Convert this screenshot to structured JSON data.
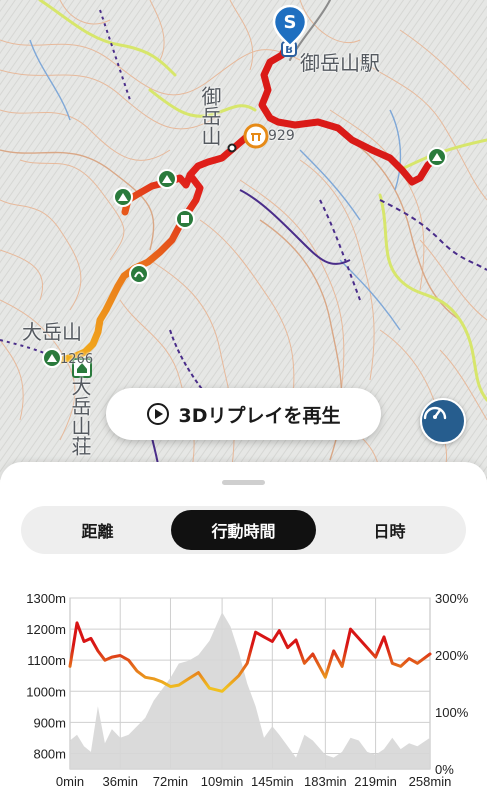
{
  "map": {
    "station_label": "御岳山駅",
    "mountain_label": "御岳山",
    "peak_label": "大岳山",
    "hut_label": "大岳山荘",
    "elev_label_1": "929",
    "elev_label_2": "1266",
    "start_marker": "S",
    "goal_marker": "G"
  },
  "replay_button": {
    "label": "3Dリプレイを再生"
  },
  "tabs": [
    {
      "label": "距離",
      "active": false
    },
    {
      "label": "行動時間",
      "active": true
    },
    {
      "label": "日時",
      "active": false
    }
  ],
  "chart_data": {
    "type": "line",
    "x": [
      0,
      5,
      10,
      15,
      20,
      25,
      30,
      36,
      42,
      48,
      54,
      60,
      66,
      72,
      78,
      85,
      92,
      100,
      109,
      115,
      121,
      127,
      133,
      139,
      145,
      150,
      156,
      162,
      168,
      174,
      183,
      189,
      195,
      201,
      207,
      213,
      219,
      225,
      231,
      237,
      243,
      249,
      258
    ],
    "xlabel_unit": "min",
    "x_tick_labels": [
      "0min",
      "36min",
      "72min",
      "109min",
      "145min",
      "183min",
      "219min",
      "258min"
    ],
    "x_ticks": [
      0,
      36,
      72,
      109,
      145,
      183,
      219,
      258
    ],
    "xlim": [
      0,
      258
    ],
    "y_left_tick_labels": [
      "800m",
      "900m",
      "1000m",
      "1100m",
      "1200m",
      "1300m"
    ],
    "y_left_ticks": [
      800,
      900,
      1000,
      1100,
      1200,
      1300
    ],
    "ylim_left": [
      750,
      1300
    ],
    "y_right_tick_labels": [
      "0%",
      "100%",
      "200%",
      "300%"
    ],
    "y_right_ticks": [
      0,
      100,
      200,
      300
    ],
    "ylim_right": [
      0,
      300
    ],
    "grid": true,
    "series": [
      {
        "axis": "left",
        "style": "line",
        "color_low": "#f0c020",
        "color_high": "#d81515",
        "values": [
          1080,
          1220,
          1160,
          1170,
          1130,
          1100,
          1110,
          1115,
          1100,
          1065,
          1045,
          1040,
          1030,
          1015,
          1020,
          1040,
          1060,
          1010,
          1000,
          1025,
          1050,
          1090,
          1190,
          1175,
          1160,
          1195,
          1140,
          1165,
          1090,
          1120,
          1045,
          1130,
          1080,
          1200,
          1170,
          1140,
          1110,
          1175,
          1090,
          1080,
          1105,
          1090,
          1120
        ]
      },
      {
        "axis": "right",
        "style": "area",
        "color": "#d6d6d6",
        "values": [
          50,
          60,
          40,
          30,
          110,
          45,
          70,
          55,
          60,
          75,
          90,
          120,
          140,
          160,
          185,
          190,
          200,
          225,
          275,
          250,
          205,
          150,
          110,
          55,
          75,
          60,
          40,
          20,
          60,
          50,
          25,
          20,
          30,
          55,
          50,
          30,
          25,
          35,
          55,
          35,
          45,
          40,
          55
        ]
      }
    ]
  }
}
